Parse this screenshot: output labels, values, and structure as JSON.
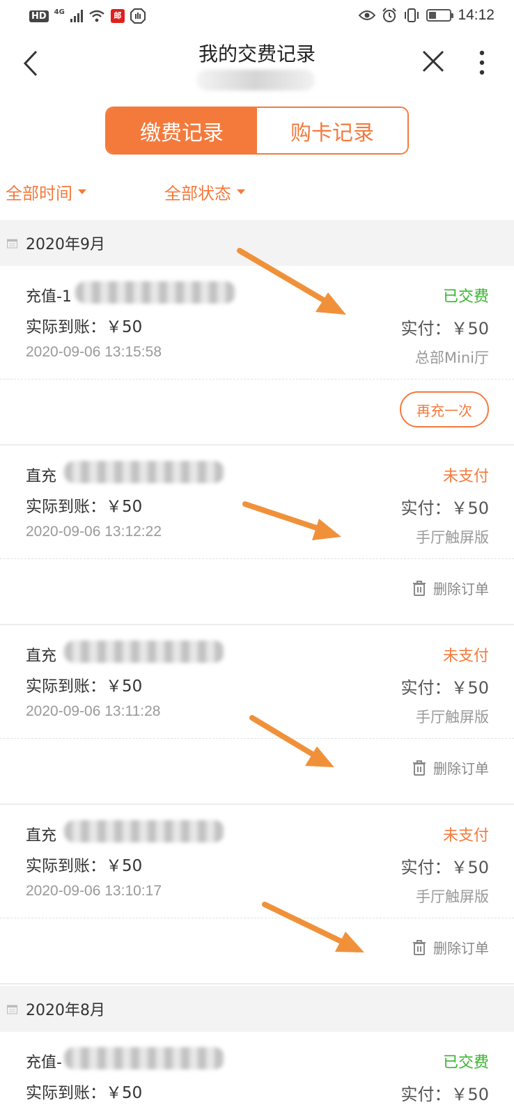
{
  "status_bar": {
    "left_icons": [
      "hd-icon",
      "4g-icon",
      "signal-icon",
      "wifi-icon",
      "post-app-icon",
      "hand-icon"
    ],
    "hd_text": "HD",
    "net_text": "4G",
    "badge_text": "邮",
    "right_icons": [
      "eye-icon",
      "alarm-icon",
      "vibrate-icon",
      "battery-icon"
    ],
    "battery_level": 0.35,
    "time": "14:12"
  },
  "header": {
    "title": "我的交费记录"
  },
  "tabs": [
    {
      "label": "缴费记录",
      "active": true
    },
    {
      "label": "购卡记录",
      "active": false
    }
  ],
  "filters": {
    "time": "全部时间",
    "status": "全部状态"
  },
  "months": [
    {
      "label": "2020年9月"
    },
    {
      "label": "2020年8月"
    }
  ],
  "records": [
    {
      "name": "充值-1",
      "amount": "实际到账：￥50",
      "date": "2020-09-06 13:15:58",
      "status": "已交费",
      "paid": "实付：￥50",
      "source": "总部Mini厅",
      "action": "再充一次"
    },
    {
      "name": "直充",
      "amount": "实际到账：￥50",
      "date": "2020-09-06 13:12:22",
      "status": "未支付",
      "paid": "实付：￥50",
      "source": "手厅触屏版",
      "action": "删除订单"
    },
    {
      "name": "直充",
      "amount": "实际到账：￥50",
      "date": "2020-09-06 13:11:28",
      "status": "未支付",
      "paid": "实付：￥50",
      "source": "手厅触屏版",
      "action": "删除订单"
    },
    {
      "name": "直充",
      "amount": "实际到账：￥50",
      "date": "2020-09-06 13:10:17",
      "status": "未支付",
      "paid": "实付：￥50",
      "source": "手厅触屏版",
      "action": "删除订单"
    },
    {
      "name": "充值-",
      "amount": "实际到账：￥50",
      "status": "已交费",
      "paid": "实付：￥50"
    }
  ],
  "colors": {
    "accent": "#f47a3c",
    "paid_status": "#35b52c",
    "annotation_arrow": "#f0913a"
  }
}
